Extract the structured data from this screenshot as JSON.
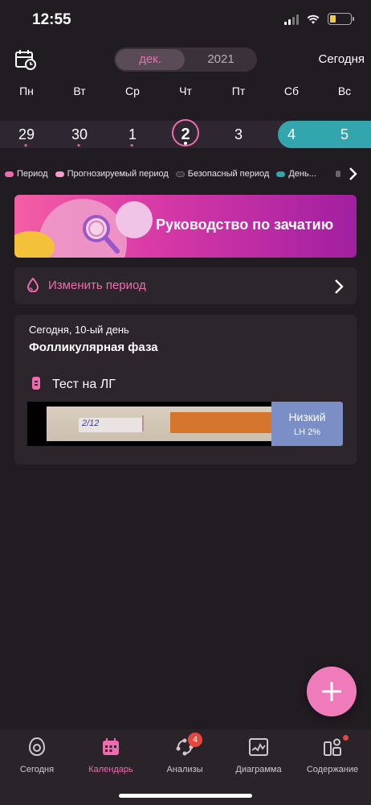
{
  "status": {
    "time": "12:55"
  },
  "header": {
    "month": "дек.",
    "year": "2021",
    "today": "Сегодня"
  },
  "weekdays": [
    "Пн",
    "Вт",
    "Ср",
    "Чт",
    "Пт",
    "Сб",
    "Вс"
  ],
  "days": [
    "29",
    "30",
    "1",
    "2",
    "3",
    "4",
    "5"
  ],
  "legend": [
    {
      "label": "Период",
      "color": "#f06ab0"
    },
    {
      "label": "Прогнозируемый период",
      "color": "#f49ccb"
    },
    {
      "label": "Безопасный период",
      "color": "#3a3238"
    },
    {
      "label": "День...",
      "color": "#33a6ad"
    }
  ],
  "banner": {
    "title": "Руководство по зачатию"
  },
  "change_period": {
    "label": "Изменить период"
  },
  "card": {
    "subtitle": "Сегодня, 10-ый день",
    "phase": "Фолликулярная фаза",
    "lh_title": "Тест на ЛГ",
    "strip_text": "2/12",
    "result_label": "Низкий",
    "result_value": "LH 2%"
  },
  "tabs": [
    {
      "label": "Сегодня",
      "icon": "today-icon"
    },
    {
      "label": "Календарь",
      "icon": "calendar-icon"
    },
    {
      "label": "Анализы",
      "icon": "analysis-icon",
      "badge": "4"
    },
    {
      "label": "Диаграмма",
      "icon": "chart-icon"
    },
    {
      "label": "Содержание",
      "icon": "content-icon"
    }
  ],
  "colors": {
    "accent": "#f06ab0",
    "fertile": "#33a6ad",
    "result": "#7c8ec6"
  }
}
